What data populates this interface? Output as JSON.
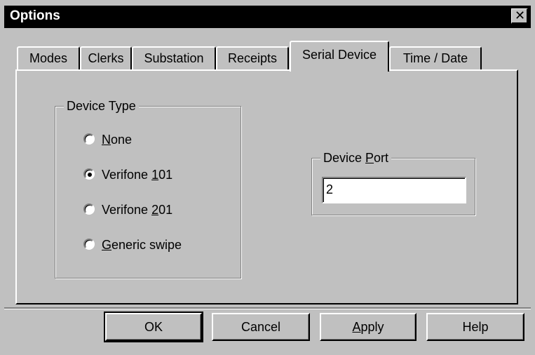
{
  "window": {
    "title": "Options",
    "close_glyph": "✕"
  },
  "tabs": [
    {
      "label": "Modes",
      "active": false
    },
    {
      "label": "Clerks",
      "active": false
    },
    {
      "label": "Substation",
      "active": false
    },
    {
      "label": "Receipts",
      "active": false
    },
    {
      "label": "Serial Device",
      "active": true
    },
    {
      "label": "Time / Date",
      "active": false
    }
  ],
  "device_type": {
    "label": "Device Type",
    "options": [
      {
        "prefix": "",
        "mnemonic": "N",
        "suffix": "one",
        "selected": false
      },
      {
        "prefix": "Verifone ",
        "mnemonic": "1",
        "suffix": "01",
        "selected": true
      },
      {
        "prefix": "Verifone ",
        "mnemonic": "2",
        "suffix": "01",
        "selected": false
      },
      {
        "prefix": "",
        "mnemonic": "G",
        "suffix": "eneric swipe",
        "selected": false
      }
    ]
  },
  "device_port": {
    "label_prefix": "Device ",
    "label_mnemonic": "P",
    "label_suffix": "ort",
    "value": "2"
  },
  "buttons": {
    "ok": "OK",
    "cancel": "Cancel",
    "apply_mnemonic": "A",
    "apply_rest": "pply",
    "help": "Help"
  },
  "colors": {
    "face": "#c0c0c0",
    "title_bar": "#000000"
  }
}
